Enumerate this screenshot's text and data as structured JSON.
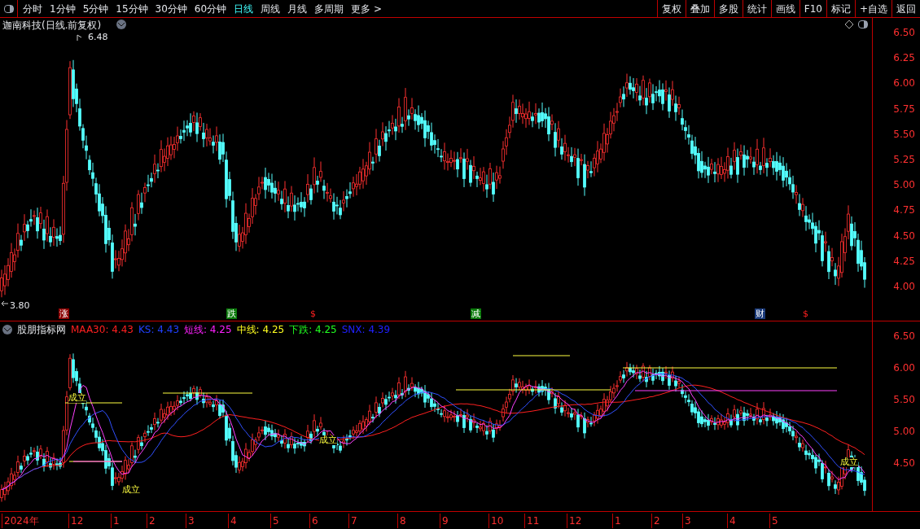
{
  "toolbar": {
    "periods": [
      {
        "label": "分时",
        "selected": false
      },
      {
        "label": "1分钟",
        "selected": false
      },
      {
        "label": "5分钟",
        "selected": false
      },
      {
        "label": "15分钟",
        "selected": false
      },
      {
        "label": "30分钟",
        "selected": false
      },
      {
        "label": "60分钟",
        "selected": false
      },
      {
        "label": "日线",
        "selected": true
      },
      {
        "label": "周线",
        "selected": false
      },
      {
        "label": "月线",
        "selected": false
      },
      {
        "label": "多周期",
        "selected": false
      },
      {
        "label": "更多 >",
        "selected": false
      }
    ],
    "actions": [
      "复权",
      "叠加",
      "多股",
      "统计",
      "画线",
      "F10",
      "标记",
      "+自选",
      "返回"
    ]
  },
  "main_pane": {
    "title": "迦南科技(日线.前复权)",
    "high_label": "6.48",
    "low_label": "3.80",
    "yticks": [
      "6.50",
      "6.25",
      "6.00",
      "5.75",
      "5.50",
      "5.25",
      "5.00",
      "4.75",
      "4.50",
      "4.25",
      "4.00"
    ],
    "signals": [
      {
        "label": "涨",
        "color": "#8b0000"
      },
      {
        "label": "跌",
        "color": "#0a7a0a"
      },
      {
        "label": "$",
        "color": "#000000"
      },
      {
        "label": "减",
        "color": "#0a7a0a"
      },
      {
        "label": "财",
        "color": "#1a3a7a"
      },
      {
        "label": "$",
        "color": "#000000"
      }
    ]
  },
  "indicator_pane": {
    "title": "股朋指标网",
    "values": [
      {
        "text": "MAA30: 4.43",
        "color": "#ff2020"
      },
      {
        "text": "KS: 4.43",
        "color": "#2040ff"
      },
      {
        "text": "短线: 4.25",
        "color": "#ff20ff"
      },
      {
        "text": "中线: 4.25",
        "color": "#ffff20"
      },
      {
        "text": "下跌: 4.25",
        "color": "#20ff20"
      },
      {
        "text": "SNX: 4.39",
        "color": "#2020ff"
      }
    ],
    "yticks": [
      "6.50",
      "6.00",
      "5.50",
      "5.00",
      "4.50"
    ],
    "markers": [
      "成立",
      "成立",
      "成立",
      "成立"
    ]
  },
  "time_axis": [
    "2024年",
    "12",
    "1",
    "2",
    "3",
    "4",
    "5",
    "6",
    "7",
    "8",
    "9",
    "10",
    "11",
    "12",
    "1",
    "2",
    "3",
    "4",
    "5"
  ]
}
